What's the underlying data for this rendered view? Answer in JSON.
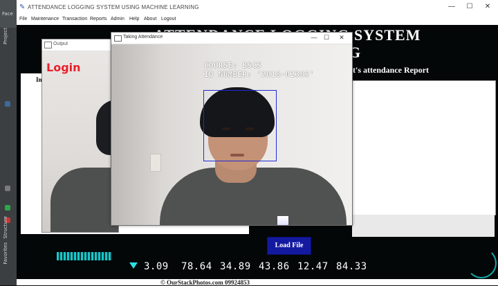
{
  "ide": {
    "top_label": "Face",
    "side_tabs": [
      "Project",
      "Structure",
      "Favorites"
    ]
  },
  "window": {
    "title": "ATTENDANCE LOGGING SYSTEM USING MACHINE LEARNING",
    "controls": [
      "—",
      "☐",
      "✕"
    ]
  },
  "menu": {
    "items": [
      "File",
      "Maintenance",
      "Transaction",
      "Reports",
      "Admin",
      "Help",
      "About",
      "Logout"
    ]
  },
  "main": {
    "title_line1": "ATTENDANCE LOGGING SYSTEM",
    "title_line2": "G",
    "report_label": "t's attendance Report",
    "left_caption": "In",
    "load_button": "Load File",
    "copyright": "© OurStackPhotos.com 09924853"
  },
  "hud": {
    "numbers": [
      "3.09",
      "78.64",
      "34.89",
      "43.86",
      "12.47",
      "84.33"
    ]
  },
  "output_window": {
    "title": "Output",
    "login_text": "Login"
  },
  "attendance_window": {
    "title": "Taking Attendance",
    "controls": [
      "—",
      "☐",
      "✕"
    ],
    "course_text": "COURSE: BSCS",
    "id_text": "ID NUMBER: '2018-02385'"
  },
  "colors": {
    "login_red": "#e8202a",
    "button_blue": "#141aa0",
    "face_box": "#1d2bd6",
    "hud_cyan": "#17c7c7"
  }
}
